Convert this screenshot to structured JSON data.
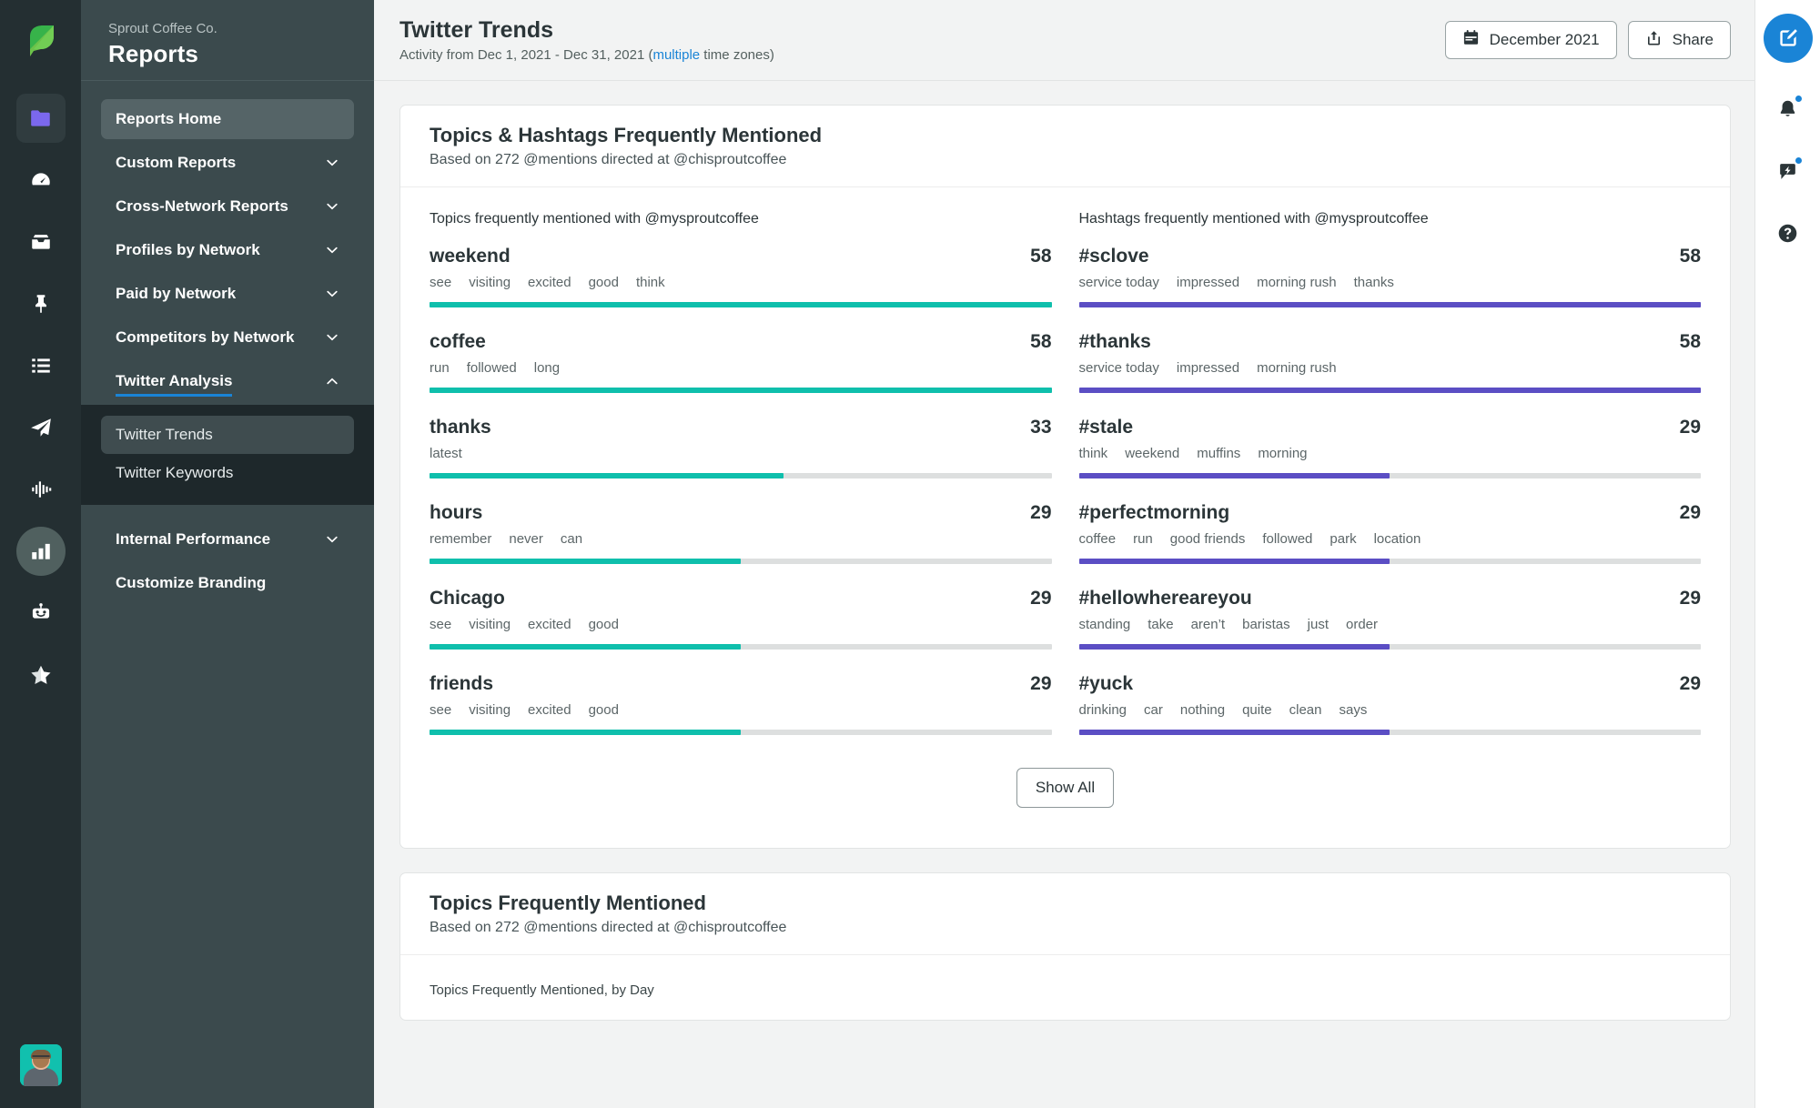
{
  "brand": {
    "logo_icon": "sprout-leaf-logo",
    "accent_blue": "#1a84d6",
    "topic_bar_color": "#0fbfac",
    "hashtag_bar_color": "#5b4ec4",
    "bar_track_color": "#dddfdf"
  },
  "sidebar": {
    "org": "Sprout Coffee Co.",
    "title": "Reports",
    "items": [
      {
        "label": "Reports Home",
        "selected": true,
        "expandable": false
      },
      {
        "label": "Custom Reports",
        "selected": false,
        "expandable": true,
        "chevron": "chevron-down-icon"
      },
      {
        "label": "Cross-Network Reports",
        "selected": false,
        "expandable": true,
        "chevron": "chevron-down-icon"
      },
      {
        "label": "Profiles by Network",
        "selected": false,
        "expandable": true,
        "chevron": "chevron-down-icon"
      },
      {
        "label": "Paid by Network",
        "selected": false,
        "expandable": true,
        "chevron": "chevron-down-icon"
      },
      {
        "label": "Competitors by Network",
        "selected": false,
        "expandable": true,
        "chevron": "chevron-down-icon"
      },
      {
        "label": "Twitter Analysis",
        "selected": false,
        "expandable": true,
        "expanded": true,
        "chevron": "chevron-up-icon"
      }
    ],
    "submenu": [
      {
        "label": "Twitter Trends",
        "selected": true
      },
      {
        "label": "Twitter Keywords",
        "selected": false
      }
    ],
    "items_after": [
      {
        "label": "Internal Performance",
        "selected": false,
        "expandable": true,
        "chevron": "chevron-down-icon"
      },
      {
        "label": "Customize Branding",
        "selected": false,
        "expandable": false
      }
    ]
  },
  "icon_rail": {
    "icons": [
      "folder-icon",
      "dashboard-gauge-icon",
      "inbox-icon",
      "pin-icon",
      "list-icon",
      "paper-plane-icon",
      "listening-waveform-icon",
      "bar-chart-icon",
      "bot-icon",
      "star-icon"
    ],
    "active_icon": "bar-chart-icon",
    "avatar": "user-avatar"
  },
  "header": {
    "title": "Twitter Trends",
    "subtitle_prefix": "Activity from Dec 1, 2021 - Dec 31, 2021 (",
    "subtitle_link": "multiple",
    "subtitle_suffix": " time zones)",
    "date_button": "December 2021",
    "date_icon": "calendar-icon",
    "share_button": "Share",
    "share_icon": "share-upload-icon"
  },
  "right_rail": {
    "compose_icon": "compose-pencil-icon",
    "items": [
      {
        "icon": "bell-notification-icon",
        "badge": true
      },
      {
        "icon": "bolt-message-icon",
        "badge": true
      },
      {
        "icon": "help-question-icon",
        "badge": false
      }
    ]
  },
  "card1": {
    "title": "Topics & Hashtags Frequently Mentioned",
    "subtitle": "Based on 272 @mentions directed at @chisproutcoffee",
    "show_all": "Show All",
    "topics_header": "Topics frequently mentioned with @mysproutcoffee",
    "hashtags_header": "Hashtags frequently mentioned with @mysproutcoffee"
  },
  "card2": {
    "title": "Topics Frequently Mentioned",
    "subtitle": "Based on 272 @mentions directed at @chisproutcoffee",
    "chart_label": "Topics Frequently Mentioned, by Day"
  },
  "chart_data": {
    "type": "bar",
    "title": "Topics & Hashtags Frequently Mentioned",
    "subtitle": "Based on 272 @mentions directed at @chisproutcoffee",
    "orientation": "horizontal",
    "max_value": 58,
    "series": [
      {
        "name": "Topics frequently mentioned with @mysproutcoffee",
        "color": "#0fbfac",
        "categories": [
          "weekend",
          "coffee",
          "thanks",
          "hours",
          "Chicago",
          "friends"
        ],
        "values": [
          58,
          58,
          33,
          29,
          29,
          29
        ],
        "related_words": [
          [
            "see",
            "visiting",
            "excited",
            "good",
            "think"
          ],
          [
            "run",
            "followed",
            "long"
          ],
          [
            "latest"
          ],
          [
            "remember",
            "never",
            "can"
          ],
          [
            "see",
            "visiting",
            "excited",
            "good"
          ],
          [
            "see",
            "visiting",
            "excited",
            "good"
          ]
        ]
      },
      {
        "name": "Hashtags frequently mentioned with @mysproutcoffee",
        "color": "#5b4ec4",
        "categories": [
          "#sclove",
          "#thanks",
          "#stale",
          "#perfectmorning",
          "#hellowhereareyou",
          "#yuck"
        ],
        "values": [
          58,
          58,
          29,
          29,
          29,
          29
        ],
        "related_words": [
          [
            "service today",
            "impressed",
            "morning rush",
            "thanks"
          ],
          [
            "service today",
            "impressed",
            "morning rush"
          ],
          [
            "think",
            "weekend",
            "muffins",
            "morning"
          ],
          [
            "coffee",
            "run",
            "good friends",
            "followed",
            "park",
            "location"
          ],
          [
            "standing",
            "take",
            "aren’t",
            "baristas",
            "just",
            "order"
          ],
          [
            "drinking",
            "car",
            "nothing",
            "quite",
            "clean",
            "says"
          ]
        ]
      }
    ]
  }
}
